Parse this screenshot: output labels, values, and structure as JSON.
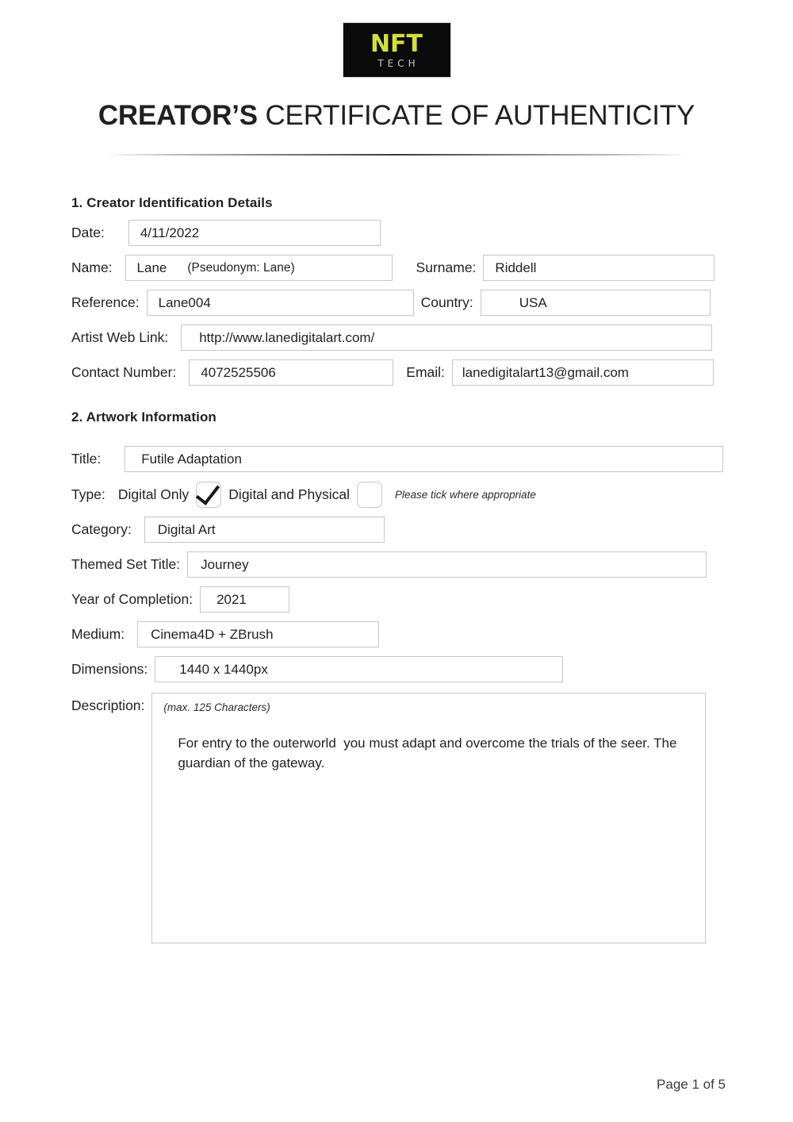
{
  "logo": {
    "primary_text": "NFT",
    "secondary_text": "TECH",
    "primary_color": "#d4e03a",
    "secondary_color": "#c9c9c9",
    "background_color": "#0b0b0b"
  },
  "header": {
    "title_bold": "CREATOR’S",
    "title_light": " CERTIFICATE OF AUTHENTICITY"
  },
  "sections": {
    "creator": {
      "heading": "1. Creator Identification Details",
      "fields": {
        "date_label": "Date:",
        "date_value": "4/11/2022",
        "name_label": "Name:",
        "name_value": "Lane",
        "name_pseudonym": "(Pseudonym: Lane)",
        "surname_label": "Surname:",
        "surname_value": "Riddell",
        "reference_label": "Reference:",
        "reference_value": "Lane004",
        "country_label": "Country:",
        "country_value": "USA",
        "weblink_label": "Artist Web Link:",
        "weblink_value": "http://www.lanedigitalart.com/",
        "contact_label": "Contact Number:",
        "contact_value": "4072525506",
        "email_label": "Email:",
        "email_value": "lanedigitalart13@gmail.com"
      }
    },
    "artwork": {
      "heading": "2. Artwork Information",
      "fields": {
        "title_label": "Title:",
        "title_value": "Futile Adaptation",
        "type_label": "Type:",
        "type_option_digital_only": "Digital Only",
        "type_option_digital_physical": "Digital and Physical",
        "type_hint": "Please tick where appropriate",
        "type_digital_only_checked": true,
        "type_digital_physical_checked": false,
        "category_label": "Category:",
        "category_value": "Digital Art",
        "themed_set_label": "Themed Set Title:",
        "themed_set_value": "Journey",
        "year_label": "Year of Completion:",
        "year_value": "2021",
        "medium_label": "Medium:",
        "medium_value": "Cinema4D + ZBrush",
        "dimensions_label": "Dimensions:",
        "dimensions_value": "1440 x 1440px",
        "description_label": "Description:",
        "description_hint": "(max. 125 Characters)",
        "description_value": "For entry to the outerworld  you must adapt and overcome the trials of the seer. The guardian of the gateway."
      }
    }
  },
  "footer": {
    "page_label": "Page 1 of 5"
  }
}
